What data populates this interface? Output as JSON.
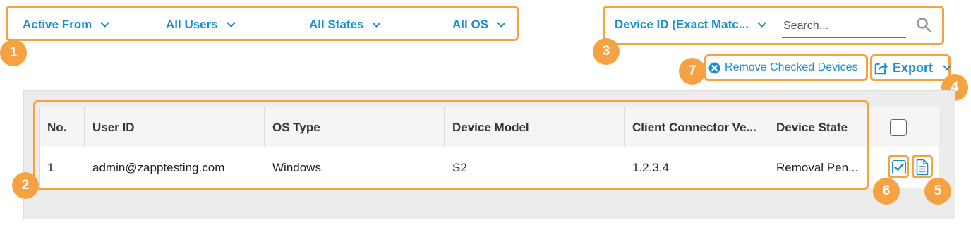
{
  "filters": [
    {
      "label": "Active From"
    },
    {
      "label": "All Users"
    },
    {
      "label": "All States"
    },
    {
      "label": "All OS"
    }
  ],
  "search": {
    "type_label": "Device ID (Exact Matc...",
    "placeholder": "Search..."
  },
  "actions": {
    "remove_label": "Remove Checked Devices",
    "export_label": "Export"
  },
  "table": {
    "columns": [
      "No.",
      "User ID",
      "OS Type",
      "Device Model",
      "Client Connector Ve...",
      "Device State"
    ],
    "rows": [
      {
        "no": "1",
        "user_id": "admin@zapptesting.com",
        "os_type": "Windows",
        "device_model": "S2",
        "client_version": "1.2.3.4",
        "device_state": "Removal Pen...",
        "checked": true
      }
    ]
  },
  "callouts": [
    "1",
    "2",
    "3",
    "4",
    "5",
    "6",
    "7"
  ],
  "colors": {
    "accent": "#1a8fcf",
    "callout": "#f5a243",
    "panel": "#ececec"
  }
}
